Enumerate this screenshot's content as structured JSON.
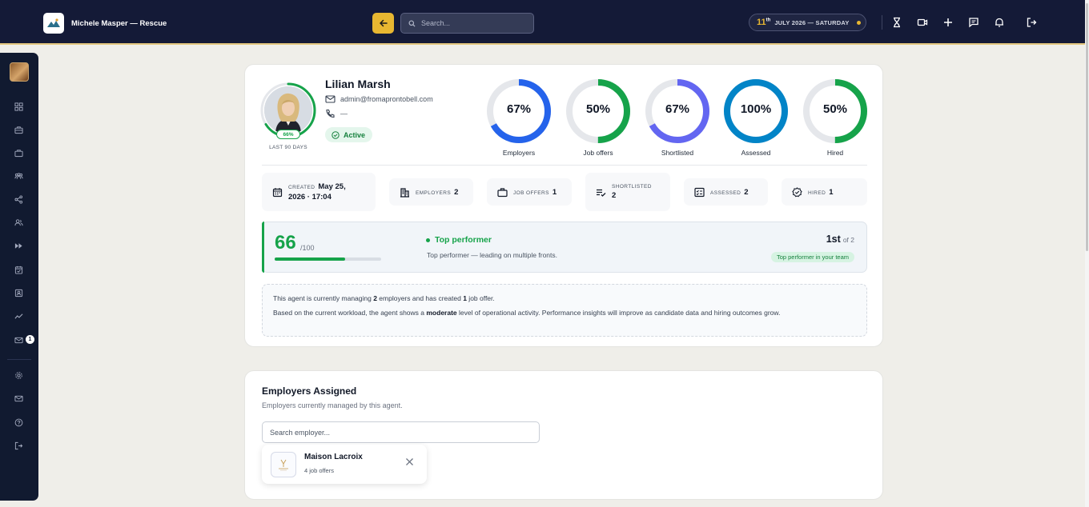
{
  "topbar": {
    "brand_name": "Michele Masper — Rescue",
    "search_placeholder": "Search...",
    "date": {
      "day": "11",
      "suffix": "th",
      "text": "JULY 2026 — SATURDAY"
    },
    "icons": [
      "hourglass-icon",
      "video-icon",
      "plus-icon",
      "chat-icon",
      "bell-icon",
      "logout-icon"
    ]
  },
  "sidebar": {
    "items": [
      "dashboard-icon",
      "briefcase-icon",
      "jobs-icon",
      "team-icon",
      "share-icon",
      "users-icon",
      "fast-forward-icon",
      "calendar-check-icon",
      "contact-card-icon",
      "trend-icon",
      "mail-icon",
      "settings-icon",
      "inbox-icon",
      "help-icon",
      "logout-icon"
    ],
    "mail_badge": "1"
  },
  "profile": {
    "name": "Lilian Marsh",
    "email": "admin@fromaprontobell.com",
    "phone": "—",
    "status": "Active",
    "score_badge": "66%",
    "score_fraction": 0.66,
    "period": "LAST 90 DAYS"
  },
  "metrics": [
    {
      "label": "Employers",
      "value": "67%",
      "pct": 67,
      "color": "#2563eb"
    },
    {
      "label": "Job offers",
      "value": "50%",
      "pct": 50,
      "color": "#16a34a"
    },
    {
      "label": "Shortlisted",
      "value": "67%",
      "pct": 67,
      "color": "#6366f1"
    },
    {
      "label": "Assessed",
      "value": "100%",
      "pct": 100,
      "color": "#0284c7"
    },
    {
      "label": "Hired",
      "value": "50%",
      "pct": 50,
      "color": "#16a34a"
    }
  ],
  "stats": {
    "created_key": "CREATED",
    "created_date": "May 25,",
    "created_time": "2026 · 17:04",
    "employers_key": "EMPLOYERS",
    "employers_val": "2",
    "joboffers_key": "JOB OFFERS",
    "joboffers_val": "1",
    "shortlisted_key": "SHORTLISTED",
    "shortlisted_val": "2",
    "assessed_key": "ASSESSED",
    "assessed_val": "2",
    "hired_key": "HIRED",
    "hired_val": "1"
  },
  "score": {
    "value": "66",
    "max": "/100",
    "fraction": 0.66,
    "title": "Top performer",
    "subtitle": "Top performer — leading on multiple fronts.",
    "rank": "1st",
    "rank_of": "of 2",
    "rank_chip": "Top performer in your team"
  },
  "info": {
    "l1_a": "This agent is currently managing ",
    "l1_b": "2",
    "l1_c": " employers and has created ",
    "l1_d": "1",
    "l1_e": " job offer.",
    "l2_a": "Based on the current workload, the agent shows a ",
    "l2_b": "moderate",
    "l2_c": " level of operational activity. Performance insights will improve as candidate data and hiring outcomes grow."
  },
  "employers": {
    "title": "Employers Assigned",
    "subtitle": "Employers currently managed by this agent.",
    "search_placeholder": "Search employer...",
    "items": [
      {
        "name": "Maison Lacroix",
        "meta": "4 job offers"
      }
    ]
  },
  "colors": {
    "topbar": "#141a37",
    "sidebar": "#111a30",
    "accent": "#e8b731",
    "success": "#16a34a"
  }
}
